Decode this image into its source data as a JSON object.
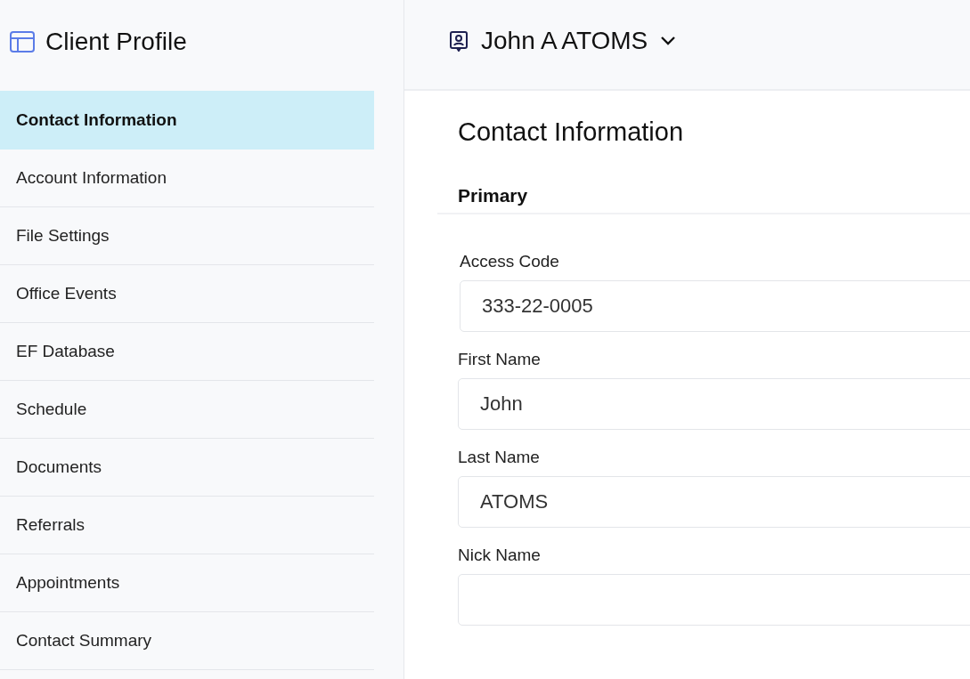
{
  "sidebar": {
    "title": "Client Profile",
    "items": [
      {
        "label": "Contact Information",
        "selected": true
      },
      {
        "label": "Account Information",
        "selected": false
      },
      {
        "label": "File Settings",
        "selected": false
      },
      {
        "label": "Office Events",
        "selected": false
      },
      {
        "label": "EF Database",
        "selected": false
      },
      {
        "label": "Schedule",
        "selected": false
      },
      {
        "label": "Documents",
        "selected": false
      },
      {
        "label": "Referrals",
        "selected": false
      },
      {
        "label": "Appointments",
        "selected": false
      },
      {
        "label": "Contact Summary",
        "selected": false
      }
    ]
  },
  "header": {
    "client_name": "John A ATOMS"
  },
  "form": {
    "title": "Contact Information",
    "section": "Primary",
    "fields": [
      {
        "label": "Access Code",
        "value": "333-22-0005"
      },
      {
        "label": "First Name",
        "value": "John"
      },
      {
        "label": "Last Name",
        "value": "ATOMS"
      },
      {
        "label": "Nick Name"
      }
    ]
  }
}
